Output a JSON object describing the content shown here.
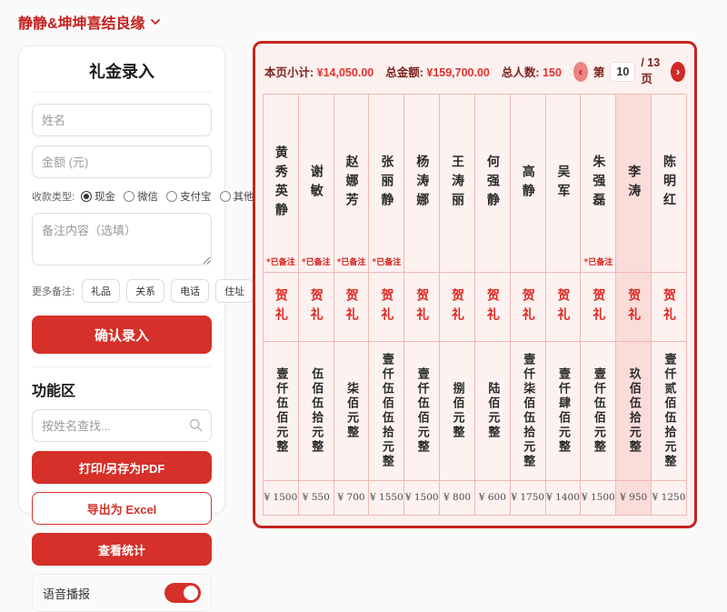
{
  "header": {
    "title": "静静&坤坤喜结良缘"
  },
  "entry_form": {
    "title": "礼金录入",
    "name_placeholder": "姓名",
    "amount_placeholder": "金额 (元)",
    "payment_label": "收款类型:",
    "payment_options": [
      {
        "label": "现金",
        "selected": true
      },
      {
        "label": "微信",
        "selected": false
      },
      {
        "label": "支付宝",
        "selected": false
      },
      {
        "label": "其他",
        "selected": false
      }
    ],
    "note_placeholder": "备注内容（选填）",
    "more_notes_label": "更多备注:",
    "note_tags": [
      "礼品",
      "关系",
      "电话",
      "住址"
    ],
    "submit_label": "确认录入"
  },
  "tools": {
    "title": "功能区",
    "search_placeholder": "按姓名查找...",
    "print_label": "打印/另存为PDF",
    "export_label": "导出为 Excel",
    "stats_label": "查看统计",
    "voice_label": "语音播报",
    "voice_on": true
  },
  "ledger": {
    "page_subtotal_label": "本页小计:",
    "page_subtotal": "¥14,050.00",
    "total_label": "总金额:",
    "total_amount": "¥159,700.00",
    "count_label": "总人数:",
    "count": "150",
    "page_prefix": "第",
    "page_current": "10",
    "page_suffix": "/ 13 页",
    "prev_icon": "‹",
    "next_icon": "›",
    "gift_label": "贺礼",
    "noted_label": "*已备注",
    "entries": [
      {
        "name": "黄秀英静",
        "noted": true,
        "amount_cn": "壹仟伍佰元整",
        "amount_num": "¥ 1500",
        "highlight": false
      },
      {
        "name": "谢敏",
        "noted": true,
        "amount_cn": "伍佰伍拾元整",
        "amount_num": "¥ 550",
        "highlight": false
      },
      {
        "name": "赵娜芳",
        "noted": true,
        "amount_cn": "柒佰元整",
        "amount_num": "¥ 700",
        "highlight": false
      },
      {
        "name": "张丽静",
        "noted": true,
        "amount_cn": "壹仟伍佰伍拾元整",
        "amount_num": "¥ 1550",
        "highlight": false
      },
      {
        "name": "杨涛娜",
        "noted": false,
        "amount_cn": "壹仟伍佰元整",
        "amount_num": "¥ 1500",
        "highlight": false
      },
      {
        "name": "王涛丽",
        "noted": false,
        "amount_cn": "捌佰元整",
        "amount_num": "¥ 800",
        "highlight": false
      },
      {
        "name": "何强静",
        "noted": false,
        "amount_cn": "陆佰元整",
        "amount_num": "¥ 600",
        "highlight": false
      },
      {
        "name": "高静",
        "noted": false,
        "amount_cn": "壹仟柒佰伍拾元整",
        "amount_num": "¥ 1750",
        "highlight": false
      },
      {
        "name": "吴军",
        "noted": false,
        "amount_cn": "壹仟肆佰元整",
        "amount_num": "¥ 1400",
        "highlight": false
      },
      {
        "name": "朱强磊",
        "noted": true,
        "amount_cn": "壹仟伍佰元整",
        "amount_num": "¥ 1500",
        "highlight": false
      },
      {
        "name": "李涛",
        "noted": false,
        "amount_cn": "玖佰伍拾元整",
        "amount_num": "¥ 950",
        "highlight": true
      },
      {
        "name": "陈明红",
        "noted": false,
        "amount_cn": "壹仟贰佰伍拾元整",
        "amount_num": "¥ 1250",
        "highlight": false
      }
    ]
  },
  "colors": {
    "accent": "#d53029",
    "panel_border": "#c32422",
    "panel_bg": "#fdf1ef",
    "cell_border": "#f2b7b2",
    "highlight_col": "#fadcd9",
    "value_red": "#e3322d",
    "label_maroon": "#7c2220"
  }
}
